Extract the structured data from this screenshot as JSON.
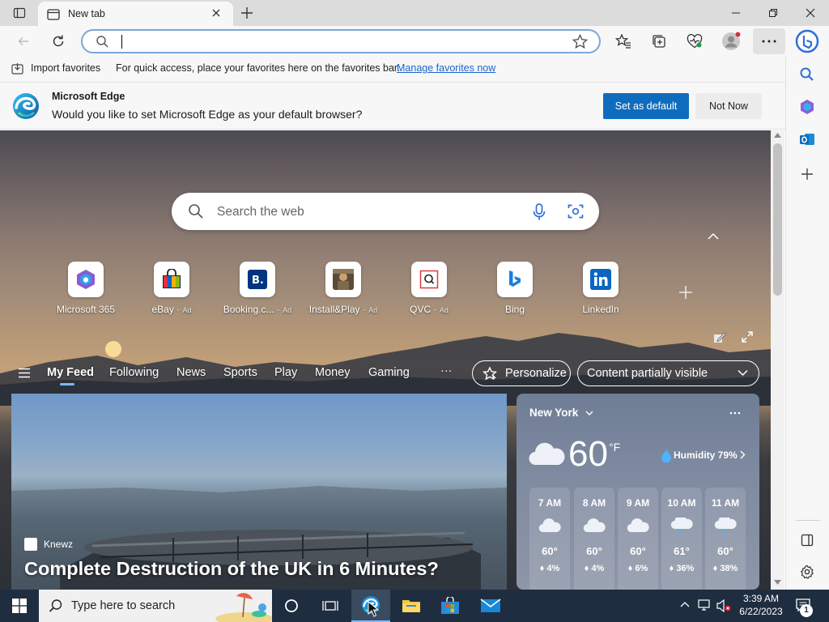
{
  "browser": {
    "tab_title": "New tab",
    "address_value": "",
    "favorites_bar": {
      "import_label": "Import favorites",
      "message": "For quick access, place your favorites here on the favorites bar.",
      "manage_link": "Manage favorites now"
    },
    "infobar": {
      "title": "Microsoft Edge",
      "question": "Would you like to set Microsoft Edge as your default browser?",
      "primary_label": "Set as default",
      "secondary_label": "Not Now"
    }
  },
  "newtab": {
    "search_placeholder": "Search the web",
    "quick_links": [
      {
        "label": "Microsoft 365",
        "ad": ""
      },
      {
        "label": "eBay",
        "ad": "Ad"
      },
      {
        "label": "Booking.c...",
        "ad": "Ad"
      },
      {
        "label": "Install&Play",
        "ad": "Ad"
      },
      {
        "label": "QVC",
        "ad": "Ad"
      },
      {
        "label": "Bing",
        "ad": ""
      },
      {
        "label": "LinkedIn",
        "ad": ""
      }
    ],
    "feed_nav": [
      "My Feed",
      "Following",
      "News",
      "Sports",
      "Play",
      "Money",
      "Gaming"
    ],
    "more_label": "···",
    "personalize_label": "Personalize",
    "visibility_label": "Content partially visible"
  },
  "hero": {
    "source": "Knewz",
    "headline": "Complete Destruction of the UK in 6 Minutes?"
  },
  "weather": {
    "city": "New York",
    "temp": "60",
    "unit": "°F",
    "humidity": "Humidity 79%",
    "hours": [
      {
        "time": "7 AM",
        "temp": "60°",
        "precip": "4%",
        "icon": "cloud-icon"
      },
      {
        "time": "8 AM",
        "temp": "60°",
        "precip": "4%",
        "icon": "cloud-icon"
      },
      {
        "time": "9 AM",
        "temp": "60°",
        "precip": "6%",
        "icon": "cloud-icon"
      },
      {
        "time": "10 AM",
        "temp": "61°",
        "precip": "36%",
        "icon": "cloud-rain-icon"
      },
      {
        "time": "11 AM",
        "temp": "60°",
        "precip": "38%",
        "icon": "cloud-rain-icon"
      }
    ]
  },
  "taskbar": {
    "search_placeholder": "Type here to search",
    "time": "3:39 AM",
    "date": "6/22/2023",
    "notification_count": "1"
  },
  "colors": {
    "accent": "#0f6cbd",
    "taskbar": "#1f2d40",
    "link": "#1a66c8"
  }
}
